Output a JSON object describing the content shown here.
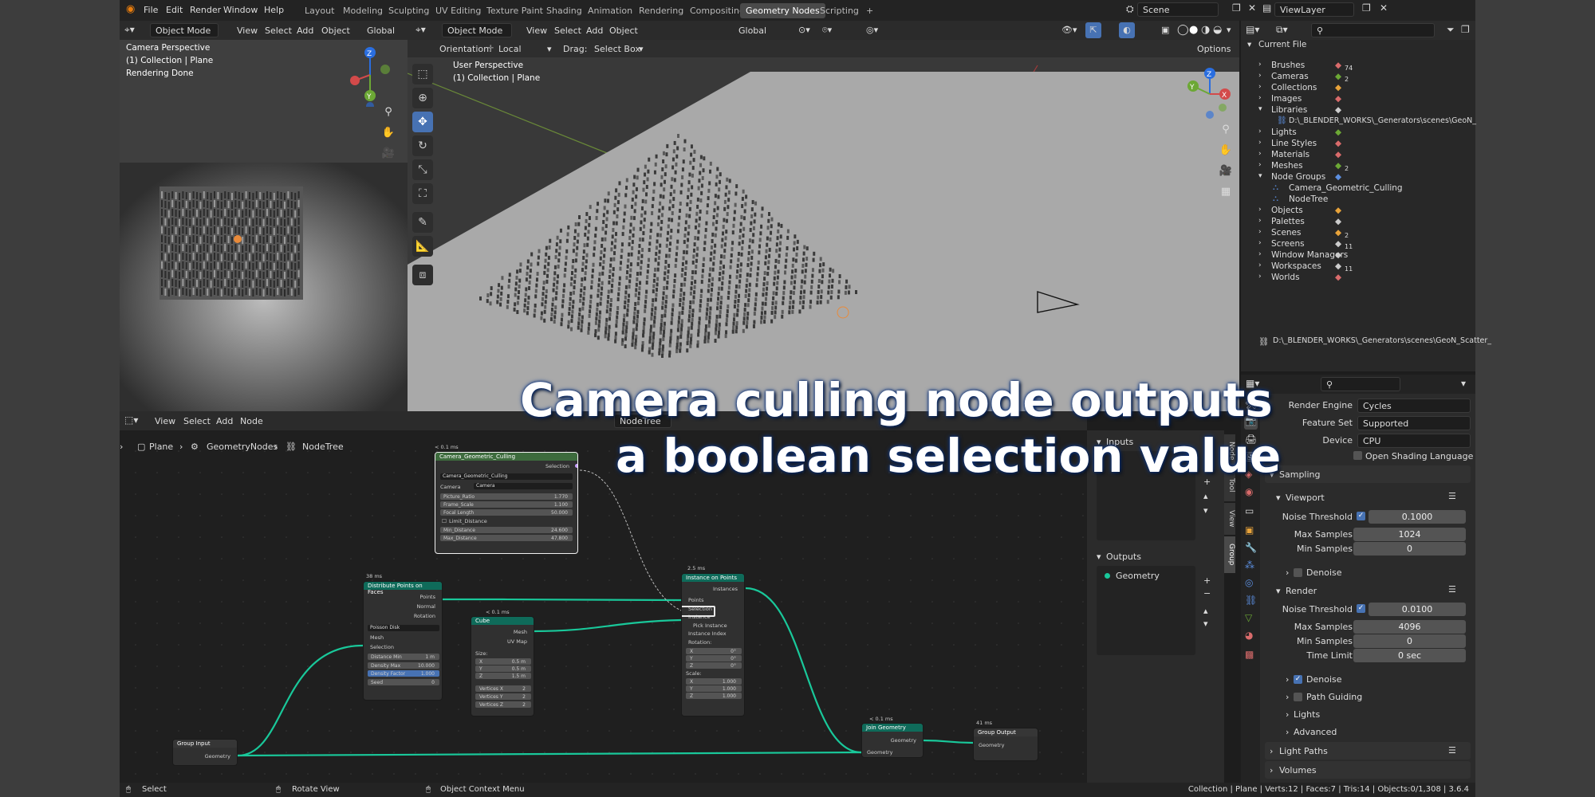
{
  "menubar": {
    "items": [
      "File",
      "Edit",
      "Render",
      "Window",
      "Help"
    ],
    "workspaces": [
      "Layout",
      "Modeling",
      "Sculpting",
      "UV Editing",
      "Texture Paint",
      "Shading",
      "Animation",
      "Rendering",
      "Compositing",
      "Geometry Nodes",
      "Scripting"
    ],
    "active_workspace": "Geometry Nodes",
    "add_tab": "+",
    "scene": "Scene",
    "view_layer": "ViewLayer"
  },
  "camera_view": {
    "mode": "Object Mode",
    "menus": [
      "View",
      "Select",
      "Add",
      "Object"
    ],
    "orientation": "Global",
    "overlay_lines": [
      "Camera Perspective",
      "(1) Collection | Plane",
      "Rendering Done"
    ]
  },
  "viewport": {
    "mode": "Object Mode",
    "menus": [
      "View",
      "Select",
      "Add",
      "Object"
    ],
    "transform_orientation": "Global",
    "orientation_label": "Orientation:",
    "orientation_value": "Local",
    "drag_label": "Drag:",
    "drag_value": "Select Box",
    "options_label": "Options",
    "overlay_lines": [
      "User Perspective",
      "(1) Collection | Plane"
    ]
  },
  "outliner": {
    "search_placeholder": "",
    "root": "Current File",
    "items": [
      {
        "label": "Brushes",
        "count": "74",
        "expanded": false
      },
      {
        "label": "Cameras",
        "count": "2",
        "expanded": false
      },
      {
        "label": "Collections",
        "count": "",
        "expanded": false
      },
      {
        "label": "Images",
        "count": "",
        "expanded": false
      },
      {
        "label": "Libraries",
        "count": "",
        "expanded": true
      },
      {
        "label": "D:\\_BLENDER_WORKS\\_Generators\\scenes\\GeoN_",
        "count": "",
        "child": true
      },
      {
        "label": "Lights",
        "count": "",
        "expanded": false
      },
      {
        "label": "Line Styles",
        "count": "",
        "expanded": false
      },
      {
        "label": "Materials",
        "count": "",
        "expanded": false
      },
      {
        "label": "Meshes",
        "count": "2",
        "expanded": false
      },
      {
        "label": "Node Groups",
        "count": "",
        "expanded": true
      },
      {
        "label": "Camera_Geometric_Culling",
        "count": "",
        "child": true
      },
      {
        "label": "NodeTree",
        "count": "",
        "child": true
      },
      {
        "label": "Objects",
        "count": "",
        "expanded": false
      },
      {
        "label": "Palettes",
        "count": "",
        "expanded": false
      },
      {
        "label": "Scenes",
        "count": "2",
        "expanded": false
      },
      {
        "label": "Screens",
        "count": "11",
        "expanded": false
      },
      {
        "label": "Window Managers",
        "count": "",
        "expanded": false
      },
      {
        "label": "Workspaces",
        "count": "11",
        "expanded": false
      },
      {
        "label": "Worlds",
        "count": "",
        "expanded": false
      }
    ],
    "footer_path": "D:\\_BLENDER_WORKS\\_Generators\\scenes\\GeoN_Scatter_"
  },
  "node_editor": {
    "menus": [
      "View",
      "Select",
      "Add",
      "Node"
    ],
    "breadcrumb": [
      "Plane",
      "GeometryNodes",
      "NodeTree"
    ],
    "tree_name": "NodeTree",
    "nodes": {
      "camera_culling": {
        "time": "< 0.1 ms",
        "title": "Camera_Geometric_Culling",
        "output": "Selection",
        "group_field": "Camera_Geometric_Culling",
        "camera_label": "Camera",
        "camera_value": "Camera",
        "fields": [
          {
            "label": "Picture_Ratio",
            "value": "1.770"
          },
          {
            "label": "Frame_Scale",
            "value": "1.100"
          },
          {
            "label": "Focal Length",
            "value": "50.000"
          }
        ],
        "checkbox": "Limit_Distance",
        "fields2": [
          {
            "label": "Min_Distance",
            "value": "24.600"
          },
          {
            "label": "Max_Distance",
            "value": "47.800"
          }
        ]
      },
      "distribute": {
        "time": "38 ms",
        "title": "Distribute Points on Faces",
        "outputs": [
          "Points",
          "Normal",
          "Rotation"
        ],
        "mode": "Poisson Disk",
        "inputs": [
          "Mesh",
          "Selection"
        ],
        "fields": [
          {
            "label": "Distance Min",
            "value": "1 m"
          },
          {
            "label": "Density Max",
            "value": "10.000"
          },
          {
            "label": "Density Factor",
            "value": "1.000"
          },
          {
            "label": "Seed",
            "value": "0"
          }
        ]
      },
      "cube": {
        "time": "< 0.1 ms",
        "title": "Cube",
        "outputs": [
          "Mesh",
          "UV Map"
        ],
        "size_label": "Size:",
        "size": [
          {
            "label": "X",
            "value": "0.5 m"
          },
          {
            "label": "Y",
            "value": "0.5 m"
          },
          {
            "label": "Z",
            "value": "1.5 m"
          }
        ],
        "verts": [
          {
            "label": "Vertices X",
            "value": "2"
          },
          {
            "label": "Vertices Y",
            "value": "2"
          },
          {
            "label": "Vertices Z",
            "value": "2"
          }
        ]
      },
      "instance": {
        "time": "2.5 ms",
        "title": "Instance on Points",
        "output": "Instances",
        "inputs": [
          "Points",
          "Selection",
          "Instance",
          "Pick Instance",
          "Instance Index",
          "Rotation:"
        ],
        "rotation": [
          {
            "label": "X",
            "value": "0°"
          },
          {
            "label": "Y",
            "value": "0°"
          },
          {
            "label": "Z",
            "value": "0°"
          }
        ],
        "scale_label": "Scale:",
        "scale": [
          {
            "label": "X",
            "value": "1.000"
          },
          {
            "label": "Y",
            "value": "1.000"
          },
          {
            "label": "Z",
            "value": "1.000"
          }
        ]
      },
      "join": {
        "time": "< 0.1 ms",
        "title": "Join Geometry",
        "output": "Geometry",
        "input": "Geometry"
      },
      "group_output": {
        "time": "41 ms",
        "title": "Group Output",
        "input": "Geometry"
      },
      "group_input": {
        "title": "Group Input",
        "output": "Geometry"
      }
    }
  },
  "group_panel": {
    "inputs_label": "Inputs",
    "outputs_label": "Outputs",
    "output_item": "Geometry",
    "side_tabs": [
      "Node",
      "Tool",
      "View",
      "Group"
    ]
  },
  "properties": {
    "render_engine_label": "Render Engine",
    "render_engine": "Cycles",
    "feature_set_label": "Feature Set",
    "feature_set": "Supported",
    "device_label": "Device",
    "device": "CPU",
    "osl_label": "Open Shading Language",
    "sampling_label": "Sampling",
    "viewport_label": "Viewport",
    "noise_threshold_label": "Noise Threshold",
    "viewport_noise": "0.1000",
    "max_samples_label": "Max Samples",
    "viewport_max": "1024",
    "min_samples_label": "Min Samples",
    "viewport_min": "0",
    "denoise_label": "Denoise",
    "render_label": "Render",
    "render_noise": "0.0100",
    "render_max": "4096",
    "render_min": "0",
    "time_limit_label": "Time Limit",
    "time_limit": "0 sec",
    "path_guiding_label": "Path Guiding",
    "lights_label": "Lights",
    "advanced_label": "Advanced",
    "light_paths_label": "Light Paths",
    "volumes_label": "Volumes"
  },
  "statusbar": {
    "select": "Select",
    "rotate": "Rotate View",
    "context": "Object Context Menu",
    "stats": "Collection | Plane | Verts:12 | Faces:7 | Tris:14 | Objects:0/1,308 | 3.6.4"
  },
  "caption": {
    "line1": "Camera culling node outputs",
    "line2": "a boolean selection value"
  }
}
